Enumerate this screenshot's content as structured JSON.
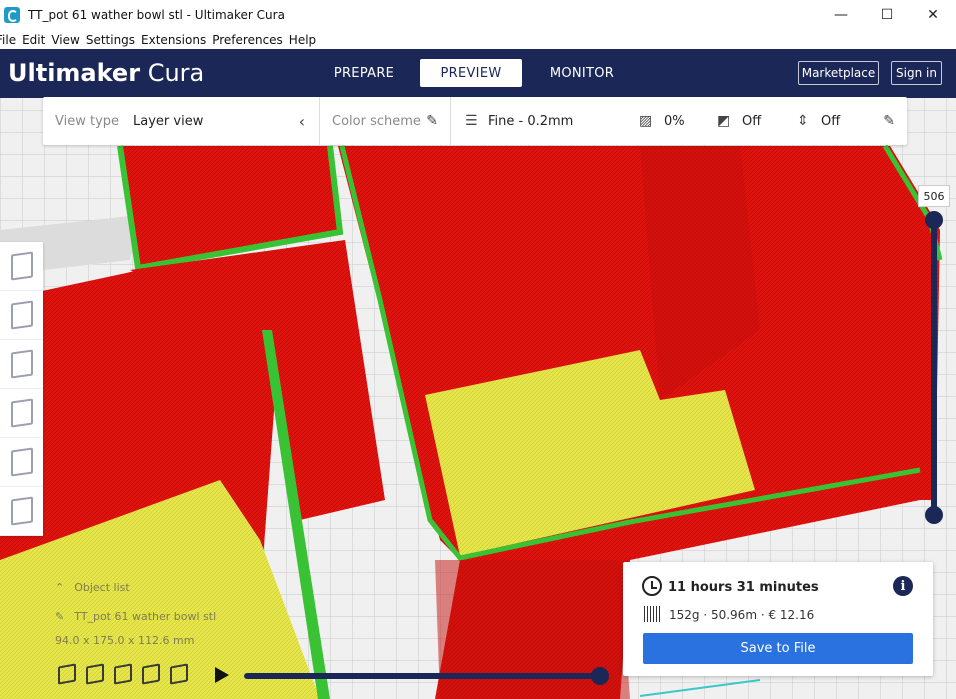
{
  "window": {
    "title": "TT_pot 61 wather bowl stl - Ultimaker Cura",
    "controls": {
      "minimize": "—",
      "maximize": "☐",
      "close": "✕"
    }
  },
  "menu": [
    "File",
    "Edit",
    "View",
    "Settings",
    "Extensions",
    "Preferences",
    "Help"
  ],
  "header": {
    "logo_bold": "Ultimaker",
    "logo_light": "Cura",
    "tabs": [
      {
        "label": "PREPARE",
        "active": false
      },
      {
        "label": "PREVIEW",
        "active": true
      },
      {
        "label": "MONITOR",
        "active": false
      }
    ],
    "marketplace_label": "Marketplace",
    "signin_label": "Sign in"
  },
  "view_bar": {
    "view_type_label": "View type",
    "view_type_value": "Layer view",
    "color_scheme_label": "Color scheme",
    "profile": "Fine - 0.2mm",
    "infill": "0%",
    "support": "Off",
    "adhesion": "Off"
  },
  "layer_slider": {
    "current_layer": "506"
  },
  "object_list": {
    "header": "Object list",
    "object_name": "TT_pot 61 wather bowl stl",
    "dimensions": "94.0 x 175.0 x 112.6 mm"
  },
  "print_info": {
    "time": "11 hours 31 minutes",
    "stats": "152g · 50.96m · € 12.16",
    "save_label": "Save to File",
    "info_glyph": "i"
  },
  "colors": {
    "brand_dark": "#1b2857",
    "accent_blue": "#2a72e0",
    "wall_red": "#e4120e",
    "skin_yellow": "#e8e84a",
    "outer_green": "#39c234"
  },
  "icons": [
    "app-icon",
    "chevron-left-icon",
    "pencil-icon",
    "profile-icon",
    "infill-icon",
    "support-icon",
    "adhesion-icon",
    "clock-icon",
    "info-icon",
    "barcode-icon",
    "play-icon"
  ]
}
